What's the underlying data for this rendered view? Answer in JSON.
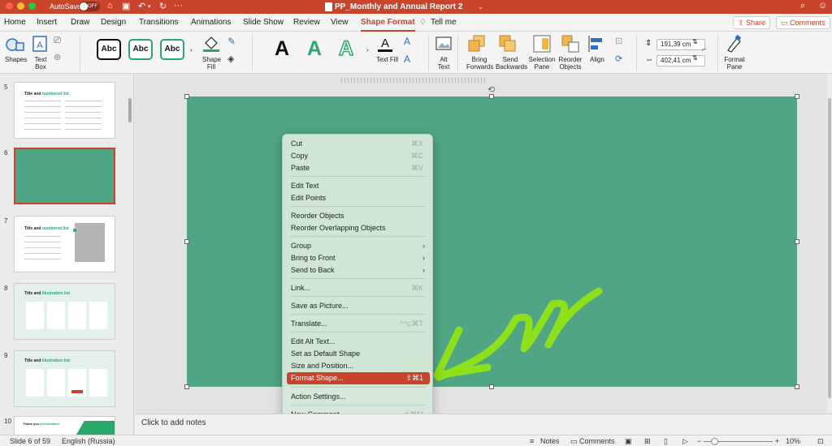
{
  "titlebar": {
    "autosave_label": "AutoSave",
    "autosave_state": "OFF",
    "doc_title": "PP_Monthly and Annual Report 2"
  },
  "tabs": [
    "Home",
    "Insert",
    "Draw",
    "Design",
    "Transitions",
    "Animations",
    "Slide Show",
    "Review",
    "View",
    "Shape Format",
    "Tell me"
  ],
  "active_tab": "Shape Format",
  "header_buttons": {
    "share": "Share",
    "comments": "Comments"
  },
  "ribbon": {
    "shapes": "Shapes",
    "text_box": "Text Box",
    "style_text": "Abc",
    "shape_fill": "Shape Fill",
    "wordart_letter": "A",
    "text_fill": "Text Fill",
    "alt_text": "Alt Text",
    "bring_forwards": "Bring Forwards",
    "send_backwards": "Send Backwards",
    "selection_pane": "Selection Pane",
    "reorder_objects": "Reorder Objects",
    "align": "Align",
    "height": "191,39 cm",
    "width": "402,41 cm",
    "format_pane": "Format Pane"
  },
  "colors": {
    "accent": "#c8452b",
    "slide_fill": "#4fa584",
    "menu_bg": "#d4e8d9",
    "annotation_arrow": "#8ee01a"
  },
  "thumbnails": [
    {
      "num": "5",
      "title_a": "Title and ",
      "title_b": "numbered list"
    },
    {
      "num": "6"
    },
    {
      "num": "7",
      "title_a": "Title and ",
      "title_b": "numbered list"
    },
    {
      "num": "8",
      "title_a": "Title and ",
      "title_b": "illustration list"
    },
    {
      "num": "9",
      "title_a": "Title and ",
      "title_b": "illustration list"
    },
    {
      "num": "10",
      "title_a": "Thank you ",
      "title_b": "presentation"
    }
  ],
  "context_menu": [
    {
      "label": "Cut",
      "shortcut": "⌘X"
    },
    {
      "label": "Copy",
      "shortcut": "⌘C"
    },
    {
      "label": "Paste",
      "shortcut": "⌘V"
    },
    {
      "label": "Edit Text"
    },
    {
      "label": "Edit Points"
    },
    {
      "label": "Reorder Objects"
    },
    {
      "label": "Reorder Overlapping Objects"
    },
    {
      "label": "Group",
      "submenu": true
    },
    {
      "label": "Bring to Front",
      "submenu": true
    },
    {
      "label": "Send to Back",
      "submenu": true
    },
    {
      "label": "Link...",
      "shortcut": "⌘K"
    },
    {
      "label": "Save as Picture..."
    },
    {
      "label": "Translate...",
      "shortcut": "^⌥⌘T"
    },
    {
      "label": "Edit Alt Text..."
    },
    {
      "label": "Set as Default Shape"
    },
    {
      "label": "Size and Position..."
    },
    {
      "label": "Format Shape...",
      "shortcut": "⇧⌘1",
      "highlighted": true
    },
    {
      "label": "Action Settings..."
    },
    {
      "label": "New Comment",
      "shortcut": "⇧⌘M"
    }
  ],
  "notes_placeholder": "Click to add notes",
  "status": {
    "slide": "Slide 6 of 59",
    "language": "English (Russia)",
    "notes": "Notes",
    "comments": "Comments",
    "zoom": "10%"
  }
}
